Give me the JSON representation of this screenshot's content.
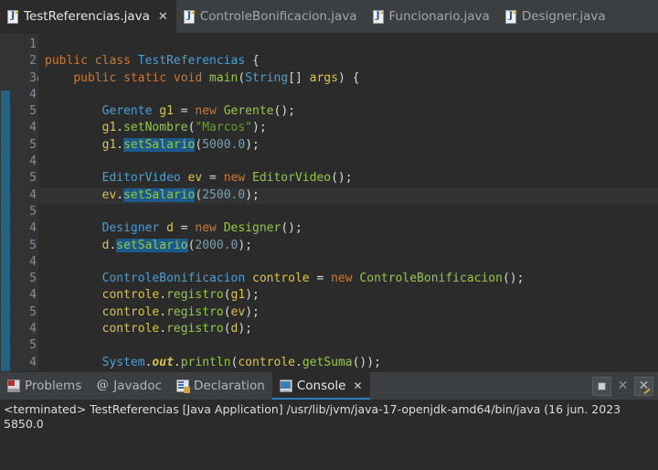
{
  "editor_tabs": [
    {
      "label": "TestReferencias.java",
      "icon": "java-file-icon",
      "active": true,
      "closable": true
    },
    {
      "label": "ControleBonificacion.java",
      "icon": "java-file-icon",
      "active": false,
      "closable": false
    },
    {
      "label": "Funcionario.java",
      "icon": "java-file-icon",
      "active": false,
      "closable": false
    },
    {
      "label": "Designer.java",
      "icon": "java-file-icon",
      "active": false,
      "closable": false
    }
  ],
  "gutter": {
    "line_numbers": [
      "1",
      "2",
      "3",
      "4",
      "5",
      "4",
      "5",
      "4",
      "5",
      "4",
      "5",
      "4",
      "5",
      "4",
      "5",
      "4",
      "5",
      "4",
      "5",
      "4",
      "5",
      "3"
    ]
  },
  "code_lines": [
    {
      "tokens": []
    },
    {
      "tokens": [
        {
          "t": "public",
          "c": "kw"
        },
        {
          "t": " ",
          "c": "plain"
        },
        {
          "t": "class",
          "c": "kw"
        },
        {
          "t": " ",
          "c": "plain"
        },
        {
          "t": "TestReferencias",
          "c": "cls"
        },
        {
          "t": " {",
          "c": "plain"
        }
      ]
    },
    {
      "fold": true,
      "tokens": [
        {
          "t": "    ",
          "c": "plain"
        },
        {
          "t": "public",
          "c": "kw"
        },
        {
          "t": " ",
          "c": "plain"
        },
        {
          "t": "static",
          "c": "kw"
        },
        {
          "t": " ",
          "c": "plain"
        },
        {
          "t": "void",
          "c": "kw"
        },
        {
          "t": " ",
          "c": "plain"
        },
        {
          "t": "main",
          "c": "meth"
        },
        {
          "t": "(",
          "c": "plain"
        },
        {
          "t": "String",
          "c": "cls"
        },
        {
          "t": "[] ",
          "c": "plain"
        },
        {
          "t": "args",
          "c": "var"
        },
        {
          "t": ") {",
          "c": "plain"
        }
      ]
    },
    {
      "tokens": []
    },
    {
      "tokens": [
        {
          "t": "        ",
          "c": "plain"
        },
        {
          "t": "Gerente",
          "c": "cls"
        },
        {
          "t": " ",
          "c": "plain"
        },
        {
          "t": "g1",
          "c": "var"
        },
        {
          "t": " = ",
          "c": "plain"
        },
        {
          "t": "new",
          "c": "kw"
        },
        {
          "t": " ",
          "c": "plain"
        },
        {
          "t": "Gerente",
          "c": "meth"
        },
        {
          "t": "();",
          "c": "plain"
        }
      ]
    },
    {
      "tokens": [
        {
          "t": "        ",
          "c": "plain"
        },
        {
          "t": "g1",
          "c": "var"
        },
        {
          "t": ".",
          "c": "plain"
        },
        {
          "t": "setNombre",
          "c": "meth"
        },
        {
          "t": "(",
          "c": "plain"
        },
        {
          "t": "\"Marcos\"",
          "c": "str"
        },
        {
          "t": ");",
          "c": "plain"
        }
      ]
    },
    {
      "tokens": [
        {
          "t": "        ",
          "c": "plain"
        },
        {
          "t": "g1",
          "c": "var"
        },
        {
          "t": ".",
          "c": "plain"
        },
        {
          "t": "setSalario",
          "c": "occ"
        },
        {
          "t": "(",
          "c": "plain"
        },
        {
          "t": "5000.0",
          "c": "num"
        },
        {
          "t": ");",
          "c": "plain"
        }
      ]
    },
    {
      "tokens": []
    },
    {
      "tokens": [
        {
          "t": "        ",
          "c": "plain"
        },
        {
          "t": "EditorVideo",
          "c": "cls"
        },
        {
          "t": " ",
          "c": "plain"
        },
        {
          "t": "ev",
          "c": "var"
        },
        {
          "t": " = ",
          "c": "plain"
        },
        {
          "t": "new",
          "c": "kw"
        },
        {
          "t": " ",
          "c": "plain"
        },
        {
          "t": "EditorVideo",
          "c": "meth"
        },
        {
          "t": "();",
          "c": "plain"
        }
      ]
    },
    {
      "current": true,
      "tokens": [
        {
          "t": "        ",
          "c": "plain"
        },
        {
          "t": "ev",
          "c": "var"
        },
        {
          "t": ".",
          "c": "plain"
        },
        {
          "t": "setSalario",
          "c": "occ"
        },
        {
          "t": "(",
          "c": "plain"
        },
        {
          "t": "2500.0",
          "c": "num"
        },
        {
          "t": ");",
          "c": "plain"
        }
      ]
    },
    {
      "tokens": []
    },
    {
      "tokens": [
        {
          "t": "        ",
          "c": "plain"
        },
        {
          "t": "Designer",
          "c": "cls"
        },
        {
          "t": " ",
          "c": "plain"
        },
        {
          "t": "d",
          "c": "var"
        },
        {
          "t": " = ",
          "c": "plain"
        },
        {
          "t": "new",
          "c": "kw"
        },
        {
          "t": " ",
          "c": "plain"
        },
        {
          "t": "Designer",
          "c": "meth"
        },
        {
          "t": "();",
          "c": "plain"
        }
      ]
    },
    {
      "tokens": [
        {
          "t": "        ",
          "c": "plain"
        },
        {
          "t": "d",
          "c": "var"
        },
        {
          "t": ".",
          "c": "plain"
        },
        {
          "t": "setSalario",
          "c": "occ"
        },
        {
          "t": "(",
          "c": "plain"
        },
        {
          "t": "2000.0",
          "c": "num"
        },
        {
          "t": ");",
          "c": "plain"
        }
      ]
    },
    {
      "tokens": []
    },
    {
      "tokens": [
        {
          "t": "        ",
          "c": "plain"
        },
        {
          "t": "ControleBonificacion",
          "c": "cls"
        },
        {
          "t": " ",
          "c": "plain"
        },
        {
          "t": "controle",
          "c": "var"
        },
        {
          "t": " = ",
          "c": "plain"
        },
        {
          "t": "new",
          "c": "kw"
        },
        {
          "t": " ",
          "c": "plain"
        },
        {
          "t": "ControleBonificacion",
          "c": "meth"
        },
        {
          "t": "();",
          "c": "plain"
        }
      ]
    },
    {
      "tokens": [
        {
          "t": "        ",
          "c": "plain"
        },
        {
          "t": "controle",
          "c": "var"
        },
        {
          "t": ".",
          "c": "plain"
        },
        {
          "t": "registro",
          "c": "meth"
        },
        {
          "t": "(",
          "c": "plain"
        },
        {
          "t": "g1",
          "c": "var"
        },
        {
          "t": ");",
          "c": "plain"
        }
      ]
    },
    {
      "tokens": [
        {
          "t": "        ",
          "c": "plain"
        },
        {
          "t": "controle",
          "c": "var"
        },
        {
          "t": ".",
          "c": "plain"
        },
        {
          "t": "registro",
          "c": "meth"
        },
        {
          "t": "(",
          "c": "plain"
        },
        {
          "t": "ev",
          "c": "var"
        },
        {
          "t": ");",
          "c": "plain"
        }
      ]
    },
    {
      "tokens": [
        {
          "t": "        ",
          "c": "plain"
        },
        {
          "t": "controle",
          "c": "var"
        },
        {
          "t": ".",
          "c": "plain"
        },
        {
          "t": "registro",
          "c": "meth"
        },
        {
          "t": "(",
          "c": "plain"
        },
        {
          "t": "d",
          "c": "var"
        },
        {
          "t": ");",
          "c": "plain"
        }
      ]
    },
    {
      "tokens": []
    },
    {
      "tokens": [
        {
          "t": "        ",
          "c": "plain"
        },
        {
          "t": "System",
          "c": "cls"
        },
        {
          "t": ".",
          "c": "plain"
        },
        {
          "t": "out",
          "c": "stat"
        },
        {
          "t": ".",
          "c": "plain"
        },
        {
          "t": "println",
          "c": "meth"
        },
        {
          "t": "(",
          "c": "plain"
        },
        {
          "t": "controle",
          "c": "var"
        },
        {
          "t": ".",
          "c": "plain"
        },
        {
          "t": "getSuma",
          "c": "meth"
        },
        {
          "t": "());",
          "c": "plain"
        }
      ]
    },
    {
      "tokens": []
    },
    {
      "tokens": [
        {
          "t": "    }",
          "c": "plain"
        }
      ]
    }
  ],
  "panel_tabs": [
    {
      "label": "Problems",
      "icon": "problems-icon",
      "active": false,
      "closable": false
    },
    {
      "label": "Javadoc",
      "icon": "javadoc-icon",
      "active": false,
      "closable": false
    },
    {
      "label": "Declaration",
      "icon": "declaration-icon",
      "active": false,
      "closable": false
    },
    {
      "label": "Console",
      "icon": "console-icon",
      "active": true,
      "closable": true
    }
  ],
  "panel_actions": [
    {
      "name": "terminate-button",
      "glyph": "stop-square-icon"
    },
    {
      "name": "remove-launch-button",
      "glyph": "close-x-icon"
    },
    {
      "name": "remove-all-terminated-button",
      "glyph": "x-hammer-icon"
    }
  ],
  "console": {
    "lines": [
      "<terminated> TestReferencias [Java Application] /usr/lib/jvm/java-17-openjdk-amd64/bin/java  (16 jun. 2023",
      "5850.0"
    ]
  },
  "colors": {
    "editor_bg": "#2b2b2b",
    "gutter_bg": "#313335",
    "chrome_bg": "#3c3f41",
    "accent": "#2a7fc0",
    "occurrence_highlight": "#1b5a8a",
    "keyword": "#cc7832",
    "class_name": "#4a9fd4",
    "method_name": "#95c648",
    "variable": "#d9c34e",
    "string": "#6a9c3f",
    "number": "#7c9fb0"
  }
}
